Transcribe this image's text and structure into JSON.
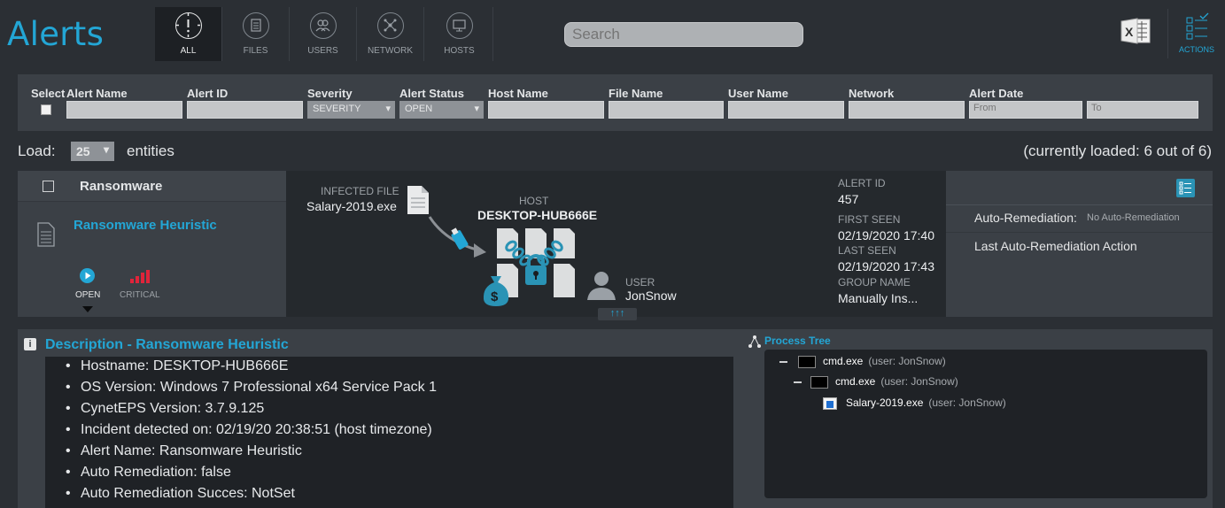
{
  "app": {
    "title": "Alerts"
  },
  "tabs": [
    {
      "label": "ALL",
      "icon": "alert-icon"
    },
    {
      "label": "FILES",
      "icon": "file-icon"
    },
    {
      "label": "USERS",
      "icon": "users-icon"
    },
    {
      "label": "NETWORK",
      "icon": "network-icon"
    },
    {
      "label": "HOSTS",
      "icon": "host-icon"
    }
  ],
  "search": {
    "placeholder": "Search"
  },
  "actions": {
    "label": "ACTIONS"
  },
  "filters": {
    "select": "Select",
    "alert_name": "Alert Name",
    "alert_id": "Alert ID",
    "severity": "Severity",
    "severity_value": "SEVERITY",
    "alert_status": "Alert Status",
    "alert_status_value": "OPEN",
    "host_name": "Host Name",
    "file_name": "File Name",
    "user_name": "User Name",
    "network": "Network",
    "alert_date": "Alert Date",
    "from_placeholder": "From",
    "to_placeholder": "To"
  },
  "load": {
    "label": "Load:",
    "value": "25",
    "suffix": "entities",
    "loaded": "(currently loaded: 6 out of 6)"
  },
  "alert": {
    "category": "Ransomware",
    "name": "Ransomware Heuristic",
    "status": "OPEN",
    "severity": "CRITICAL",
    "infected_file_label": "INFECTED FILE",
    "infected_file": "Salary-2019.exe",
    "host_label": "HOST",
    "host": "DESKTOP-HUB666E",
    "user_label": "USER",
    "user": "JonSnow",
    "expand": "↑↑↑",
    "alert_id_label": "ALERT ID",
    "alert_id": "457",
    "first_seen_label": "FIRST SEEN",
    "first_seen": "02/19/2020 17:40",
    "last_seen_label": "LAST SEEN",
    "last_seen": "02/19/2020 17:43",
    "group_label": "GROUP NAME",
    "group": "Manually Ins...",
    "auto_remediation_label": "Auto-Remediation:",
    "auto_remediation_value": "No Auto-Remediation",
    "last_action_label": "Last Auto-Remediation Action"
  },
  "description": {
    "title": "Description - Ransomware Heuristic",
    "items": [
      "Hostname: DESKTOP-HUB666E",
      "OS Version: Windows 7 Professional x64 Service Pack 1",
      "CynetEPS Version: 3.7.9.125",
      "Incident detected on: 02/19/20 20:38:51 (host timezone)",
      "Alert Name: Ransomware Heuristic",
      "Auto Remediation: false",
      "Auto Remediation Succes: NotSet"
    ]
  },
  "process_tree": {
    "title": "Process Tree",
    "nodes": [
      {
        "name": "cmd.exe",
        "user": "(user: JonSnow)"
      },
      {
        "name": "cmd.exe",
        "user": "(user: JonSnow)"
      },
      {
        "name": "Salary-2019.exe",
        "user": "(user: JonSnow)"
      }
    ]
  },
  "colors": {
    "accent": "#23a6d5",
    "critical": "#e0243a",
    "panel": "#3b4046",
    "background": "#2b2f34"
  }
}
